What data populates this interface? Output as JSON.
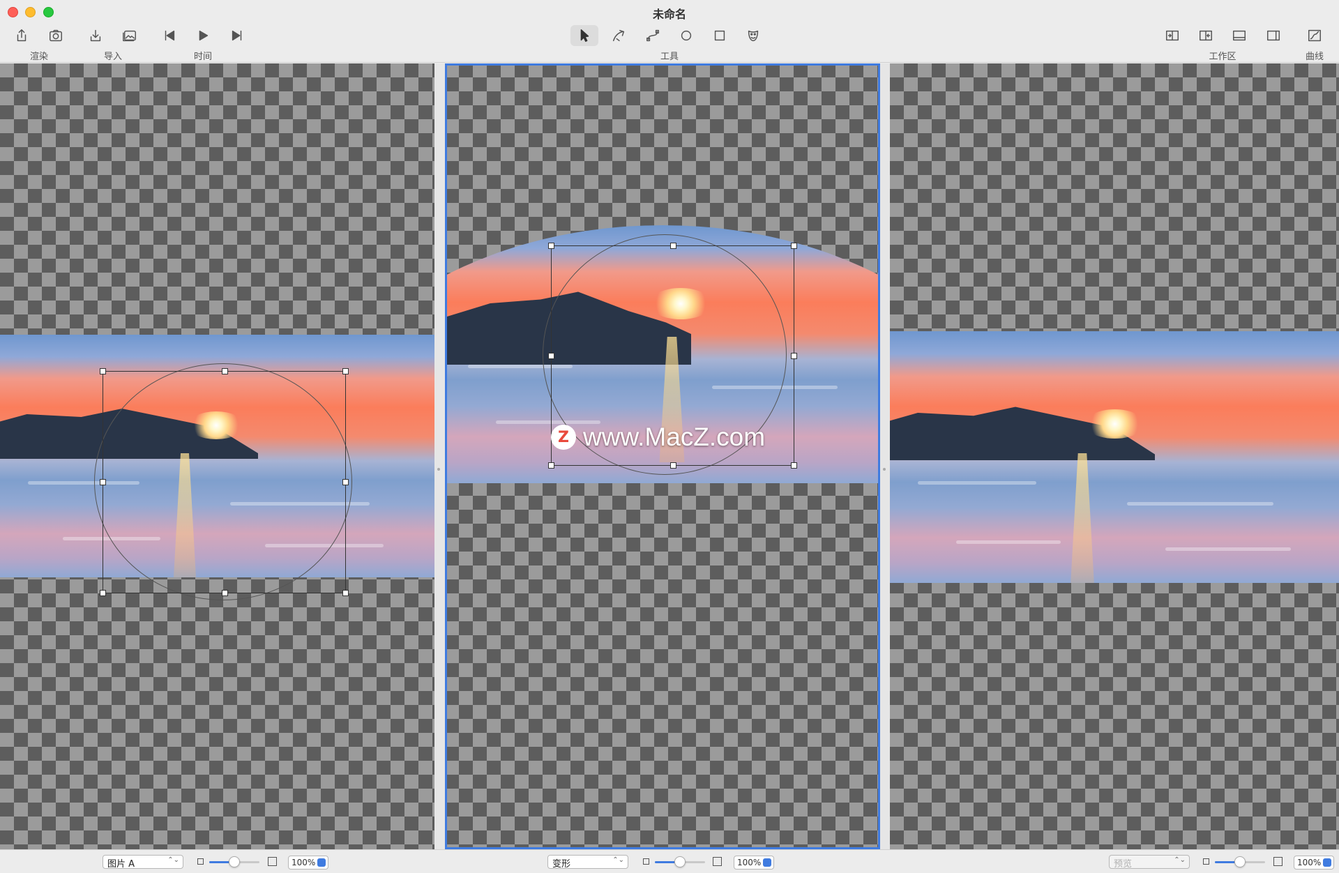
{
  "window": {
    "title": "未命名"
  },
  "toolbar": {
    "groups": {
      "render": "渲染",
      "import": "导入",
      "time": "时间",
      "tools": "工具",
      "workspace": "工作区",
      "curves": "曲线"
    },
    "selected_tool": "select"
  },
  "watermark": {
    "badge": "Z",
    "text": "www.MacZ.com"
  },
  "bottombar": {
    "left": {
      "popup": "图片 A",
      "zoom": "100%",
      "slider_level": 0.5
    },
    "center": {
      "popup": "变形",
      "zoom": "100%",
      "slider_level": 0.5
    },
    "right": {
      "popup": "预览",
      "zoom": "100%",
      "slider_level": 0.5
    }
  },
  "colors": {
    "accent": "#3f7be0",
    "checker_dark": "#5d5d5d",
    "checker_light": "#9b9b9b"
  }
}
